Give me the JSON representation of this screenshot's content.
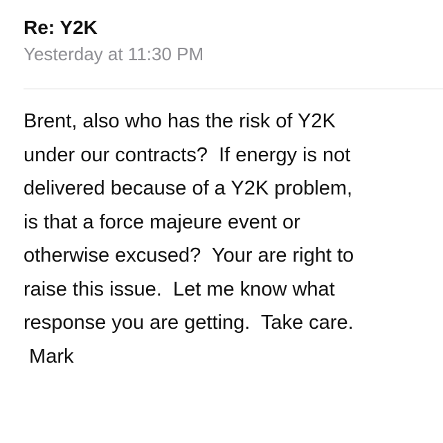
{
  "message": {
    "subject": "Re: Y2K",
    "timestamp": "Yesterday at 11:30 PM",
    "body_lines": [
      "Brent, also who has the risk of Y2K",
      "under our contracts?  If energy is not",
      "delivered because of a Y2K problem,",
      "is that a force majeure event or",
      "otherwise excused?  Your are right to",
      "raise this issue.  Let me know what",
      "response you are getting.  Take care.",
      " Mark"
    ]
  }
}
